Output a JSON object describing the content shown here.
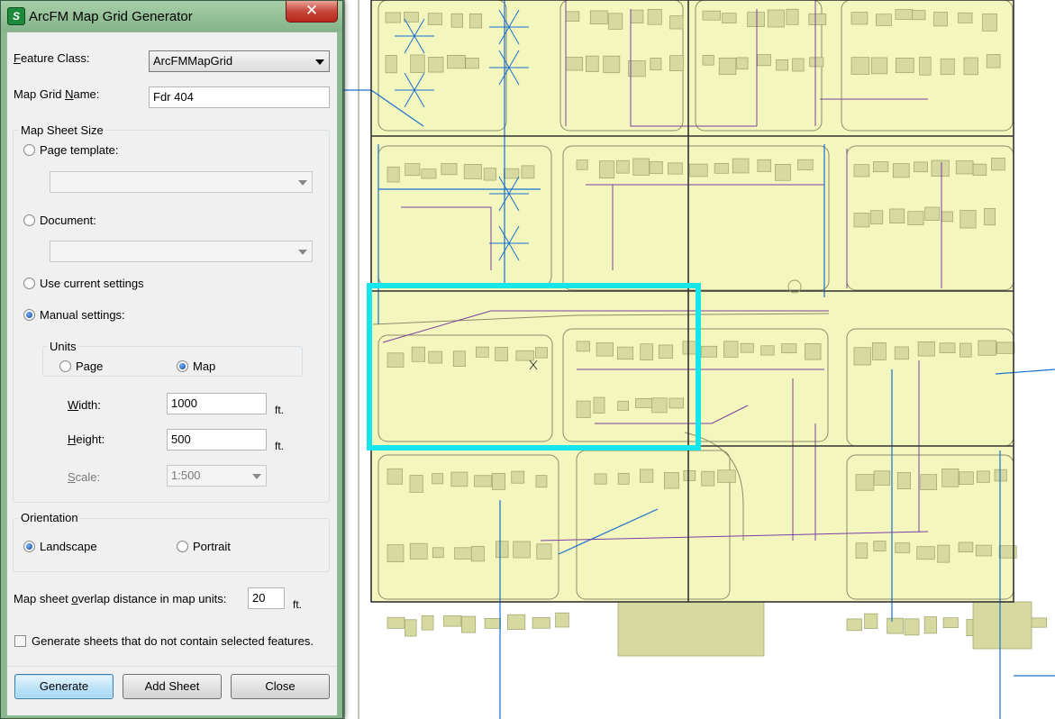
{
  "dialog": {
    "title": "ArcFM Map Grid Generator",
    "app_icon_glyph": "S",
    "close_glyph": "✕",
    "feature_class": {
      "label_pre": "",
      "label_u": "F",
      "label_post": "eature Class:",
      "value": "ArcFMMapGrid"
    },
    "grid_name": {
      "label_pre": "Map Grid ",
      "label_u": "N",
      "label_post": "ame:",
      "value": "Fdr 404"
    },
    "sheet_size": {
      "title": "Map Sheet Size",
      "page_template": "Page template:",
      "document": "Document:",
      "use_current": "Use current settings",
      "manual": "Manual settings:",
      "selected": "manual",
      "units": {
        "title": "Units",
        "page": "Page",
        "map": "Map",
        "selected": "map"
      },
      "width": {
        "label_pre": "",
        "label_u": "W",
        "label_post": "idth:",
        "value": "1000",
        "unit": "ft."
      },
      "height": {
        "label_pre": "",
        "label_u": "H",
        "label_post": "eight:",
        "value": "500",
        "unit": "ft."
      },
      "scale": {
        "label_pre": "",
        "label_u": "S",
        "label_post": "cale:",
        "value": "1:500"
      }
    },
    "orientation": {
      "title": "Orientation",
      "landscape": "Landscape",
      "portrait": "Portrait",
      "selected": "landscape"
    },
    "overlap": {
      "label_pre": "Map sheet ",
      "label_u": "o",
      "label_post": "verlap distance in map units:",
      "value": "20",
      "unit": "ft."
    },
    "generate_empty": {
      "label": "Generate sheets that do not contain selected features.",
      "checked": false
    },
    "buttons": {
      "generate": "Generate",
      "add_sheet": "Add Sheet",
      "close": "Close"
    }
  },
  "colors": {
    "parcel_fill": "#f3f7be",
    "building_fill": "#d6d9a0",
    "grid_line": "#333333",
    "selection_box": "#16e6ec",
    "primary_line": "#1a6fd0",
    "secondary_line": "#7b3fa3"
  }
}
